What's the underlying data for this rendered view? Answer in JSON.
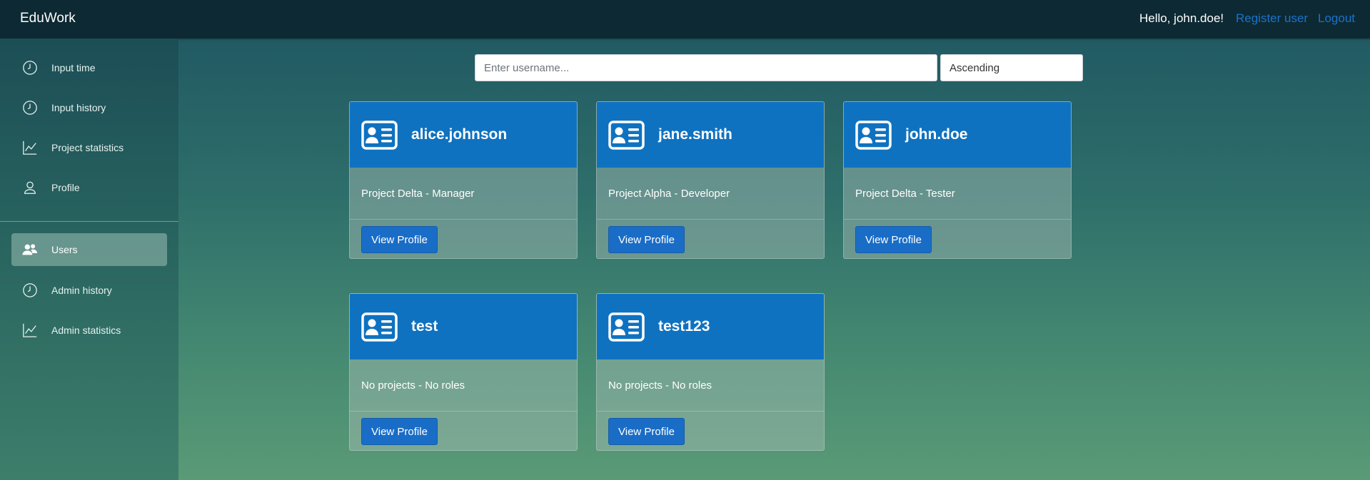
{
  "app": {
    "brand": "EduWork",
    "greeting": "Hello, john.doe!",
    "register_link": "Register user",
    "logout_link": "Logout"
  },
  "sidebar": {
    "items": [
      {
        "label": "Input time",
        "icon": "clock-icon"
      },
      {
        "label": "Input history",
        "icon": "clock-icon"
      },
      {
        "label": "Project statistics",
        "icon": "chart-line-icon"
      },
      {
        "label": "Profile",
        "icon": "person-icon"
      },
      {
        "label": "Users",
        "icon": "users-icon",
        "active": true
      },
      {
        "label": "Admin history",
        "icon": "clock-icon"
      },
      {
        "label": "Admin statistics",
        "icon": "chart-line-icon"
      }
    ]
  },
  "search": {
    "placeholder": "Enter username...",
    "value": ""
  },
  "sort": {
    "selected": "Ascending"
  },
  "users": [
    {
      "username": "alice.johnson",
      "details": "Project Delta - Manager",
      "button": "View Profile"
    },
    {
      "username": "jane.smith",
      "details": "Project Alpha - Developer",
      "button": "View Profile"
    },
    {
      "username": "john.doe",
      "details": "Project Delta - Tester",
      "button": "View Profile"
    },
    {
      "username": "test",
      "details": "No projects - No roles",
      "button": "View Profile"
    },
    {
      "username": "test123",
      "details": "No projects - No roles",
      "button": "View Profile"
    }
  ],
  "colors": {
    "topbar": "#0d2933",
    "card_header": "#0f72c0",
    "button": "#1a6dc6",
    "link": "#1a73c9"
  }
}
